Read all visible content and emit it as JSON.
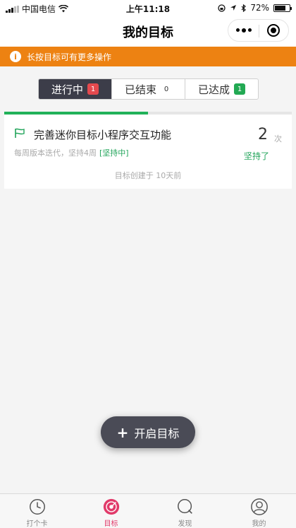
{
  "statusbar": {
    "carrier": "中国电信",
    "time": "上午11:18",
    "battery": "72%"
  },
  "nav": {
    "title": "我的目标"
  },
  "notice": {
    "icon": "info-icon",
    "text": "长按目标可有更多操作"
  },
  "tabs": [
    {
      "label": "进行中",
      "count": "1"
    },
    {
      "label": "已结束",
      "count": "0"
    },
    {
      "label": "已达成",
      "count": "1"
    }
  ],
  "goal": {
    "progress": 0.5,
    "title": "完善迷你目标小程序交互功能",
    "frequency": "每周版本迭代，坚持4周",
    "status": "[坚持中]",
    "count": "2",
    "count_unit": "次",
    "count_label": "坚持了",
    "created": "目标创建于  10天前"
  },
  "fab": {
    "label": "开启目标"
  },
  "tabbar": [
    {
      "label": "打个卡",
      "icon": "clock-icon"
    },
    {
      "label": "目标",
      "icon": "target-icon"
    },
    {
      "label": "发现",
      "icon": "discover-icon"
    },
    {
      "label": "我的",
      "icon": "profile-icon"
    }
  ],
  "colors": {
    "accent": "#e13a6a",
    "notice": "#ed8212",
    "green": "#21a45a",
    "dark": "#3c3d49"
  }
}
